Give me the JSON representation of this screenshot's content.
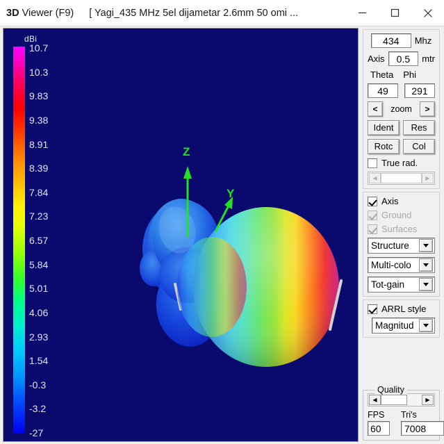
{
  "titlebar": {
    "app_prefix": "3D",
    "app_name": " Viewer (F9)",
    "document_title": "[  Yagi_435 MHz 5el dijametar 2.6mm 50 omi ...",
    "minimize_label": "minimize",
    "maximize_label": "maximize",
    "close_label": "close"
  },
  "viewport": {
    "colorbar": {
      "unit": "dBi",
      "ticks": [
        "10.7",
        "10.3",
        "9.83",
        "9.38",
        "8.91",
        "8.39",
        "7.84",
        "7.23",
        "6.57",
        "5.84",
        "5.01",
        "4.06",
        "2.93",
        "1.54",
        "-0.3",
        "-3.2",
        "-27"
      ]
    },
    "axes": [
      {
        "name": "z-axis-label",
        "label": "Z"
      },
      {
        "name": "y-axis-label",
        "label": "Y"
      }
    ],
    "background_color": "#0a0a6e",
    "axis_color": "#24e024"
  },
  "sidebar": {
    "frequency": {
      "value": "434",
      "unit": "Mhz"
    },
    "axis": {
      "label": "Axis",
      "value": "0.5",
      "unit": "mtr"
    },
    "angles": {
      "theta_label": "Theta",
      "phi_label": "Phi",
      "theta_value": "49",
      "phi_value": "291"
    },
    "zoom": {
      "prev": "<",
      "label": "zoom",
      "next": ">"
    },
    "buttons": {
      "ident": "Ident",
      "res": "Res",
      "rotc": "Rotc",
      "col": "Col"
    },
    "true_rad": {
      "label": "True rad.",
      "checked": false
    },
    "display_options": [
      {
        "label": "Axis",
        "checked": true,
        "enabled": true
      },
      {
        "label": "Ground",
        "checked": true,
        "enabled": false
      },
      {
        "label": "Surfaces",
        "checked": true,
        "enabled": false
      }
    ],
    "dropdowns": {
      "structure": "Structure",
      "color_mode": "Multi-colo",
      "gain_mode": "Tot-gain",
      "plot_mode": "Magnitud"
    },
    "arrl": {
      "label": "ARRL style",
      "checked": true
    },
    "quality": {
      "legend": "Quality"
    },
    "stats": {
      "fps_label": "FPS",
      "tris_label": "Tri's",
      "fps_value": "60",
      "tris_value": "7008"
    }
  }
}
